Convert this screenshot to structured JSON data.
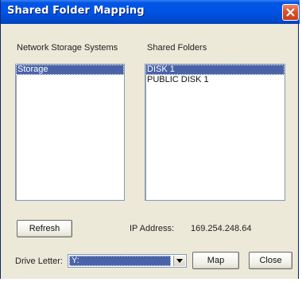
{
  "window": {
    "title": "Shared Folder Mapping"
  },
  "network_storage": {
    "label": "Network Storage Systems",
    "items": [
      {
        "label": "Storage",
        "selected": true
      }
    ]
  },
  "shared_folders": {
    "label": "Shared Folders",
    "items": [
      {
        "label": "DISK 1",
        "selected": true
      },
      {
        "label": "PUBLIC DISK 1",
        "selected": false
      }
    ]
  },
  "actions": {
    "refresh_label": "Refresh",
    "map_label": "Map",
    "close_label": "Close"
  },
  "ip": {
    "label": "IP Address:",
    "value": "169.254.248.64"
  },
  "drive_letter": {
    "label": "Drive Letter:",
    "value": "Y:"
  },
  "icons": {
    "close": "close-icon",
    "dropdown": "chevron-down-icon"
  },
  "colors": {
    "titlebar": "#0054e3",
    "selection": "#4a63a8",
    "dialog_background": "#ece9d8",
    "close_button": "#d9522b"
  }
}
